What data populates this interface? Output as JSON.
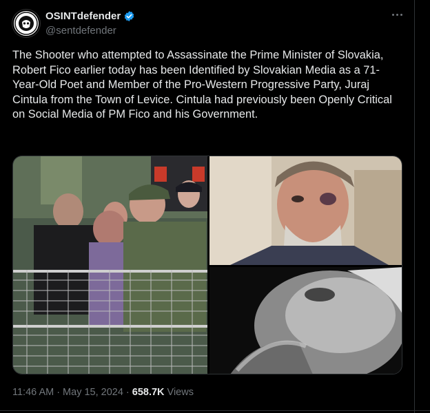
{
  "author": {
    "display_name": "OSINTdefender",
    "handle": "@sentdefender",
    "verified_icon": "verified-badge-icon",
    "avatar_icon": "osintdefender-logo-icon"
  },
  "tweet": {
    "text": "The Shooter who attempted to Assassinate the Prime Minister of Slovakia, Robert Fico earlier today has been Identified by Slovakian Media as a 71-Year-Old Poet and Member of the Pro-Western Progressive Party, Juraj Cintula from the Town of Levice. Cintula had previously been Openly Critical on Social Media of PM Fico and his Government.",
    "media": [
      {
        "icon": "photo-arrest-scene"
      },
      {
        "icon": "photo-portrait-man-bruised-eye"
      },
      {
        "icon": "photo-portrait-black-and-white"
      }
    ]
  },
  "meta": {
    "time": "11:46 AM",
    "separator_1": "·",
    "date": "May 15, 2024",
    "separator_2": "·",
    "views_count": "658.7K",
    "views_label": "Views"
  },
  "colors": {
    "background": "#000000",
    "text_primary": "#e7e9ea",
    "text_secondary": "#71767b",
    "verified_blue": "#1d9bf0",
    "border": "#2f3336"
  }
}
